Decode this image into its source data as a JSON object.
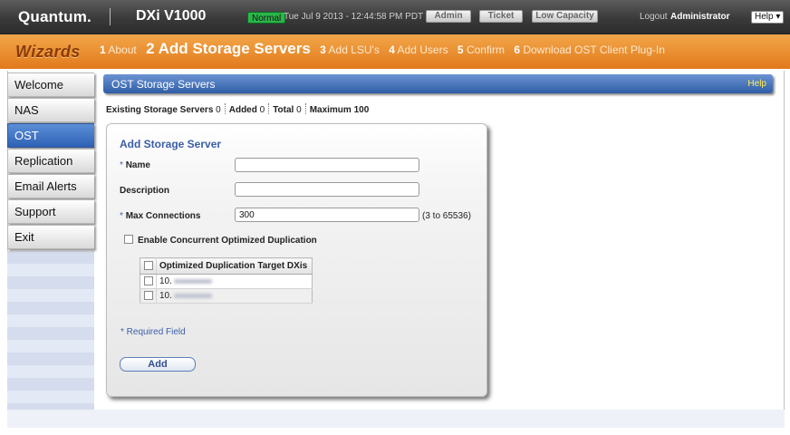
{
  "header": {
    "brand": "Quantum.",
    "model": "DXi V1000",
    "status_badge": "Normal",
    "datetime": "Tue Jul 9 2013 - 12:44:58 PM PDT",
    "buttons": {
      "admin": "Admin",
      "ticket": "Ticket",
      "low_capacity": "Low Capacity"
    },
    "logout_label": "Logout",
    "username": "Administrator",
    "help_menu": "Help ▾"
  },
  "wizard": {
    "title": "Wizards",
    "steps": [
      {
        "num": "1",
        "label": "About"
      },
      {
        "num": "2",
        "label": "Add Storage Servers"
      },
      {
        "num": "3",
        "label": "Add LSU's"
      },
      {
        "num": "4",
        "label": "Add Users"
      },
      {
        "num": "5",
        "label": "Confirm"
      },
      {
        "num": "6",
        "label": "Download OST Client Plug-In"
      }
    ],
    "active_step": 2
  },
  "sidebar": {
    "items": [
      {
        "label": "Welcome"
      },
      {
        "label": "NAS"
      },
      {
        "label": "OST"
      },
      {
        "label": "Replication"
      },
      {
        "label": "Email Alerts"
      },
      {
        "label": "Support"
      },
      {
        "label": "Exit"
      }
    ],
    "active": "OST"
  },
  "panel": {
    "title": "OST Storage Servers",
    "help": "Help"
  },
  "summary": {
    "existing_label": "Existing Storage Servers",
    "existing_value": "0",
    "added_label": "Added",
    "added_value": "0",
    "total_label": "Total",
    "total_value": "0",
    "maximum_label": "Maximum",
    "maximum_value": "100"
  },
  "form": {
    "title": "Add Storage Server",
    "name_label": "Name",
    "name_value": "",
    "description_label": "Description",
    "description_value": "",
    "max_connections_label": "Max Connections",
    "max_connections_value": "300",
    "max_connections_range": "(3 to 65536)",
    "concurrent_label": "Enable Concurrent Optimized Duplication",
    "concurrent_checked": false,
    "required_marker": "*",
    "required_note": "* Required Field",
    "add_button": "Add"
  },
  "dup_table": {
    "header": "Optimized Duplication Target DXis",
    "rows": [
      {
        "prefix": "10."
      },
      {
        "prefix": "10."
      }
    ]
  }
}
